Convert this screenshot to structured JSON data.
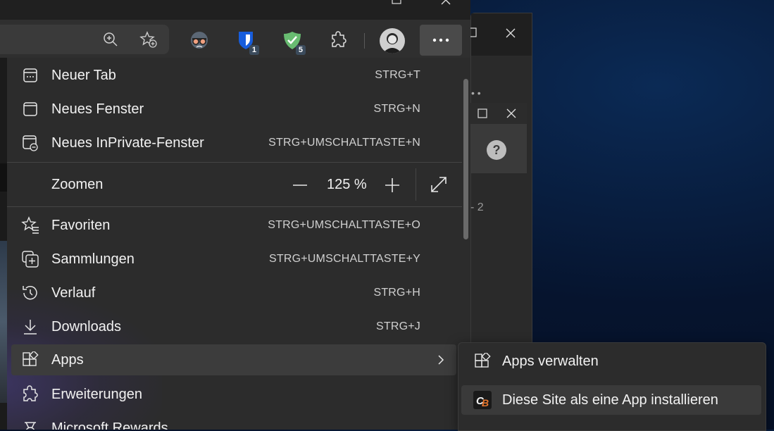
{
  "menu": {
    "items": [
      {
        "label": "Neuer Tab",
        "shortcut": "STRG+T",
        "icon": "new-tab-icon"
      },
      {
        "label": "Neues Fenster",
        "shortcut": "STRG+N",
        "icon": "new-window-icon"
      },
      {
        "label": "Neues InPrivate-Fenster",
        "shortcut": "STRG+UMSCHALTTASTE+N",
        "icon": "inprivate-window-icon"
      }
    ],
    "zoom": {
      "label": "Zoomen",
      "value": "125 %"
    },
    "items2": [
      {
        "label": "Favoriten",
        "shortcut": "STRG+UMSCHALTTASTE+O",
        "icon": "favorites-icon"
      },
      {
        "label": "Sammlungen",
        "shortcut": "STRG+UMSCHALTTASTE+Y",
        "icon": "collections-icon"
      },
      {
        "label": "Verlauf",
        "shortcut": "STRG+H",
        "icon": "history-icon"
      },
      {
        "label": "Downloads",
        "shortcut": "STRG+J",
        "icon": "downloads-icon"
      },
      {
        "label": "Apps",
        "shortcut": "",
        "icon": "apps-icon"
      },
      {
        "label": "Erweiterungen",
        "shortcut": "",
        "icon": "extensions-icon"
      },
      {
        "label": "Microsoft Rewards",
        "shortcut": "",
        "icon": "rewards-icon"
      }
    ]
  },
  "submenu": {
    "items": [
      {
        "label": "Apps verwalten",
        "icon": "apps-manage-icon"
      },
      {
        "label": "Diese Site als eine App installieren",
        "icon": "site-app-logo-icon"
      }
    ]
  },
  "toolbar": {
    "extension_badges": {
      "bitwarden": "1",
      "adguard": "5"
    }
  },
  "background": {
    "page_number_fragment": "- 2"
  },
  "colors": {
    "menu_bg": "#2c2c2c",
    "active_bg": "#3c3c3c",
    "desktop_bg": "#06142e"
  }
}
